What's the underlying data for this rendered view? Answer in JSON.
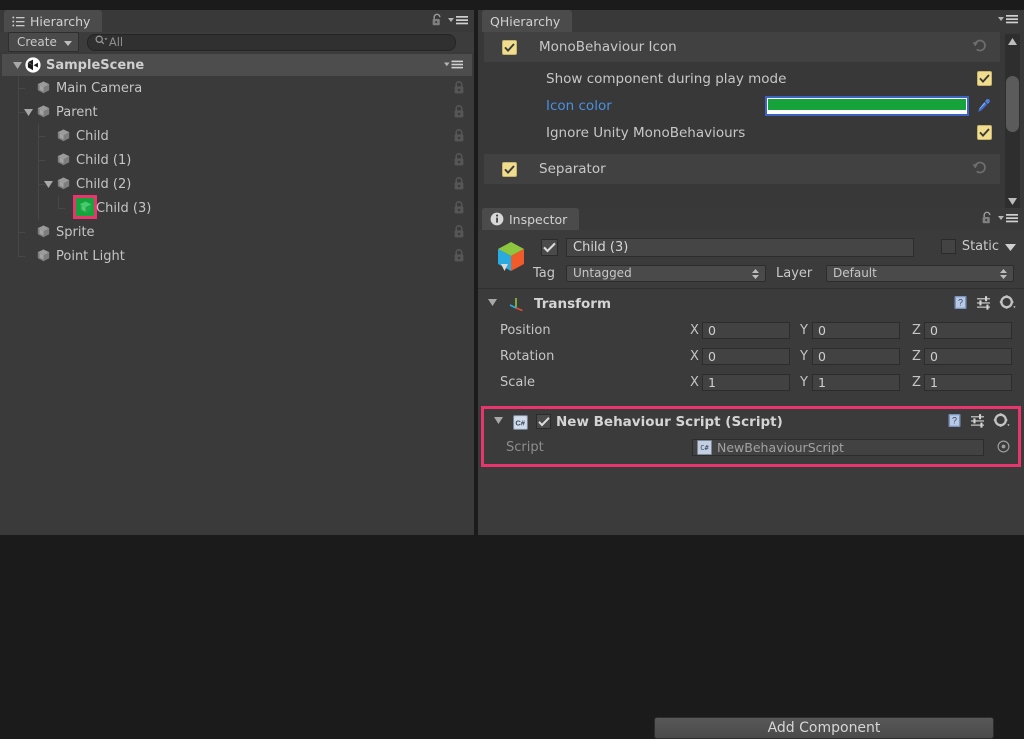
{
  "hierarchy_panel": {
    "tab_label": "Hierarchy",
    "tab_icon": "list-icon",
    "lock_icon": "lock-open-icon",
    "menu_icon": "panel-menu-icon",
    "create_button": "Create",
    "search_placeholder": "All",
    "search_icon": "search-icon",
    "scene": {
      "name": "SampleScene",
      "icon": "unity-scene-icon",
      "expanded": true,
      "menu_icon": "scene-menu-icon"
    },
    "items": [
      {
        "label": "Main Camera",
        "depth": 1,
        "expandable": false,
        "expanded": false,
        "selected": false,
        "icon": "gameobject-icon",
        "lock_icon": "lock-icon"
      },
      {
        "label": "Parent",
        "depth": 1,
        "expandable": true,
        "expanded": true,
        "selected": false,
        "icon": "gameobject-icon",
        "lock_icon": "lock-icon"
      },
      {
        "label": "Child",
        "depth": 2,
        "expandable": false,
        "expanded": false,
        "selected": false,
        "icon": "gameobject-icon",
        "lock_icon": "lock-icon"
      },
      {
        "label": "Child (1)",
        "depth": 2,
        "expandable": false,
        "expanded": false,
        "selected": false,
        "icon": "gameobject-icon",
        "lock_icon": "lock-icon"
      },
      {
        "label": "Child (2)",
        "depth": 2,
        "expandable": true,
        "expanded": true,
        "selected": false,
        "icon": "gameobject-icon",
        "lock_icon": "lock-icon"
      },
      {
        "label": "Child (3)",
        "depth": 3,
        "expandable": false,
        "expanded": false,
        "selected": true,
        "icon": "gameobject-icon-green",
        "lock_icon": "lock-icon"
      },
      {
        "label": "Sprite",
        "depth": 1,
        "expandable": false,
        "expanded": false,
        "selected": false,
        "icon": "gameobject-icon",
        "lock_icon": "lock-icon"
      },
      {
        "label": "Point Light",
        "depth": 1,
        "expandable": false,
        "expanded": false,
        "selected": false,
        "icon": "gameobject-icon",
        "lock_icon": "lock-icon"
      }
    ]
  },
  "qhierarchy_panel": {
    "tab_label": "QHierarchy",
    "menu_icon": "panel-menu-icon",
    "sections": [
      {
        "title": "MonoBehaviour Icon",
        "enabled": true,
        "revert_icon": "revert-icon",
        "rows": [
          {
            "label": "Show component during play mode",
            "type": "checkbox",
            "value": true
          },
          {
            "label": "Icon color",
            "type": "color",
            "value": "#16A33C",
            "is_link": true,
            "eyedropper_icon": "eyedropper-icon"
          },
          {
            "label": "Ignore Unity MonoBehaviours",
            "type": "checkbox",
            "value": true
          }
        ]
      },
      {
        "title": "Separator",
        "enabled": true,
        "revert_icon": "revert-icon",
        "rows": []
      }
    ],
    "scrollbar": {
      "up_icon": "scroll-up-arrow",
      "down_icon": "scroll-down-arrow"
    }
  },
  "inspector_panel": {
    "tab_label": "Inspector",
    "tab_icon": "info-icon",
    "lock_icon": "lock-open-icon",
    "menu_icon": "panel-menu-icon",
    "object": {
      "icon": "prefab-cube-icon",
      "active": true,
      "name": "Child (3)",
      "static_label": "Static",
      "static_checked": false,
      "static_dropdown_icon": "chevron-down-icon",
      "tag_label": "Tag",
      "tag_value": "Untagged",
      "layer_label": "Layer",
      "layer_value": "Default"
    },
    "components": [
      {
        "name": "Transform",
        "icon": "transform-axis-icon",
        "expanded": true,
        "highlighted": false,
        "has_enable_toggle": false,
        "tools": [
          "help-icon",
          "preset-icon",
          "gear-icon"
        ],
        "vectors": [
          {
            "label": "Position",
            "x": "0",
            "y": "0",
            "z": "0"
          },
          {
            "label": "Rotation",
            "x": "0",
            "y": "0",
            "z": "0"
          },
          {
            "label": "Scale",
            "x": "1",
            "y": "1",
            "z": "1"
          }
        ],
        "axis_labels": [
          "X",
          "Y",
          "Z"
        ]
      },
      {
        "name": "New Behaviour Script (Script)",
        "icon": "csharp-script-icon",
        "expanded": true,
        "highlighted": true,
        "has_enable_toggle": true,
        "enabled": true,
        "tools": [
          "help-icon",
          "preset-icon",
          "gear-icon"
        ],
        "field": {
          "label": "Script",
          "value": "NewBehaviourScript",
          "value_icon": "csharp-script-icon",
          "picker_icon": "object-picker-icon"
        }
      }
    ],
    "add_component_button": "Add Component"
  },
  "colors": {
    "highlight_pink": "#E8356D",
    "checkbox_yellow": "#F0DD8D",
    "icon_green": "#16A33C",
    "link_blue": "#4A8FE0",
    "panel_bg": "#383838"
  }
}
